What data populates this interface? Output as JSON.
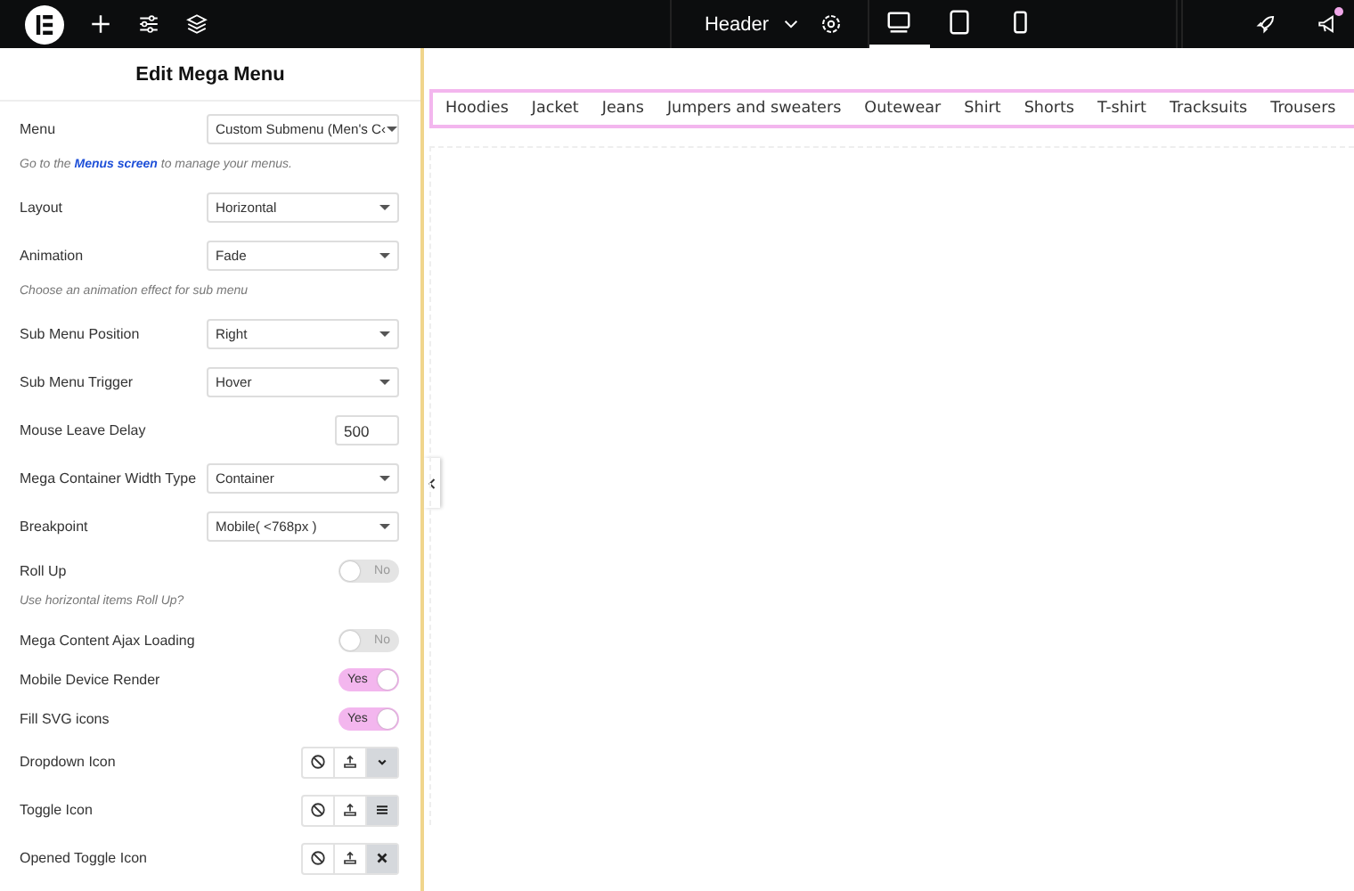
{
  "topbar": {
    "template": "Header",
    "devices": [
      {
        "kind": "desktop",
        "selected": true
      },
      {
        "kind": "tablet",
        "selected": false
      },
      {
        "kind": "mobile",
        "selected": false
      }
    ],
    "notification": true
  },
  "panel": {
    "title": "Edit Mega Menu",
    "rows": [
      {
        "kind": "select",
        "label": "Menu",
        "value": "Custom Submenu (Men's C‹"
      },
      {
        "kind": "note",
        "before": "Go to the ",
        "link": "Menus screen",
        "after": " to manage your menus."
      },
      {
        "kind": "select",
        "label": "Layout",
        "value": "Horizontal"
      },
      {
        "kind": "select",
        "label": "Animation",
        "value": "Fade"
      },
      {
        "kind": "note",
        "before": "Choose an animation effect for sub menu"
      },
      {
        "kind": "select",
        "label": "Sub Menu Position",
        "value": "Right"
      },
      {
        "kind": "select",
        "label": "Sub Menu Trigger",
        "value": "Hover"
      },
      {
        "kind": "number",
        "label": "Mouse Leave Delay",
        "value": "500"
      },
      {
        "kind": "select",
        "label": "Mega Container Width Type",
        "value": "Container"
      },
      {
        "kind": "select",
        "label": "Breakpoint",
        "value": "Mobile( <768px )"
      },
      {
        "kind": "switch",
        "label": "Roll Up",
        "on": false,
        "text": "No"
      },
      {
        "kind": "note",
        "before": "Use horizontal items Roll Up?"
      },
      {
        "kind": "switch",
        "label": "Mega Content Ajax Loading",
        "on": false,
        "text": "No"
      },
      {
        "kind": "switch",
        "label": "Mobile Device Render",
        "on": true,
        "text": "Yes"
      },
      {
        "kind": "switch",
        "label": "Fill SVG icons",
        "on": true,
        "text": "Yes"
      },
      {
        "kind": "icons",
        "label": "Dropdown Icon",
        "options": [
          {
            "kind": "none",
            "selected": false
          },
          {
            "kind": "upload",
            "selected": false
          },
          {
            "kind": "chevron",
            "selected": true
          }
        ]
      },
      {
        "kind": "icons",
        "label": "Toggle Icon",
        "options": [
          {
            "kind": "none",
            "selected": false
          },
          {
            "kind": "upload",
            "selected": false
          },
          {
            "kind": "bars",
            "selected": true
          }
        ]
      },
      {
        "kind": "icons",
        "label": "Opened Toggle Icon",
        "options": [
          {
            "kind": "none",
            "selected": false
          },
          {
            "kind": "upload",
            "selected": false
          },
          {
            "kind": "close",
            "selected": true
          }
        ]
      }
    ]
  },
  "menu_items": [
    "Hoodies",
    "Jacket",
    "Jeans",
    "Jumpers and sweaters",
    "Outewear",
    "Shirt",
    "Shorts",
    "T-shirt",
    "Tracksuits",
    "Trousers"
  ]
}
